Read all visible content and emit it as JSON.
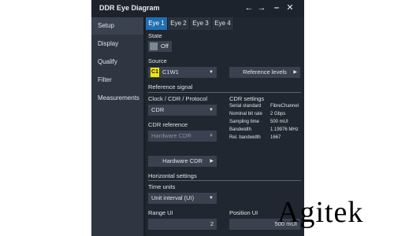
{
  "window": {
    "title": "DDR Eye Diagram",
    "buttons": {
      "back": "←",
      "forward": "→",
      "minimize": "–",
      "close": "✕"
    }
  },
  "sidebar": {
    "items": [
      {
        "label": "Setup"
      },
      {
        "label": "Display"
      },
      {
        "label": "Qualify"
      },
      {
        "label": "Filter"
      },
      {
        "label": "Measurements"
      }
    ]
  },
  "tabs": [
    {
      "label": "Eye 1"
    },
    {
      "label": "Eye 2"
    },
    {
      "label": "Eye 3"
    },
    {
      "label": "Eye 4"
    }
  ],
  "setup": {
    "state": {
      "label": "State",
      "value": "Off"
    },
    "source": {
      "label": "Source",
      "badge": "C1",
      "value": "C1W1",
      "reference_levels_button": "Reference levels"
    },
    "reference_signal": {
      "title": "Reference signal",
      "clock_label": "Clock / CDR / Protocol",
      "clock_value": "CDR",
      "cdr_reference_label": "CDR reference",
      "cdr_reference_value": "Hardware CDR",
      "hardware_cdr_button": "Hardware CDR"
    },
    "cdr_settings": {
      "title": "CDR settings",
      "rows": [
        {
          "k": "Serial standard",
          "v": "FibreChannel"
        },
        {
          "k": "Nominal bit rate",
          "v": "2 Gbps"
        },
        {
          "k": "Sampling time",
          "v": "500 mUI"
        },
        {
          "k": "Bandwidth",
          "v": "1.19976 MHz"
        },
        {
          "k": "Rel. bandwidth",
          "v": "1667"
        }
      ]
    },
    "horizontal": {
      "title": "Horizontal settings",
      "time_units_label": "Time units",
      "time_units_value": "Unit interval (UI)",
      "range_label": "Range UI",
      "range_value": "2",
      "position_label": "Position UI",
      "position_value": "500 mUI"
    }
  },
  "watermark": {
    "text": "Agitek"
  },
  "colors": {
    "title_bar": "#1d232c",
    "sidebar": "#2f3642",
    "content": "#202730",
    "tab_active": "#1f6fb2",
    "badge_c1": "#f2e600"
  }
}
